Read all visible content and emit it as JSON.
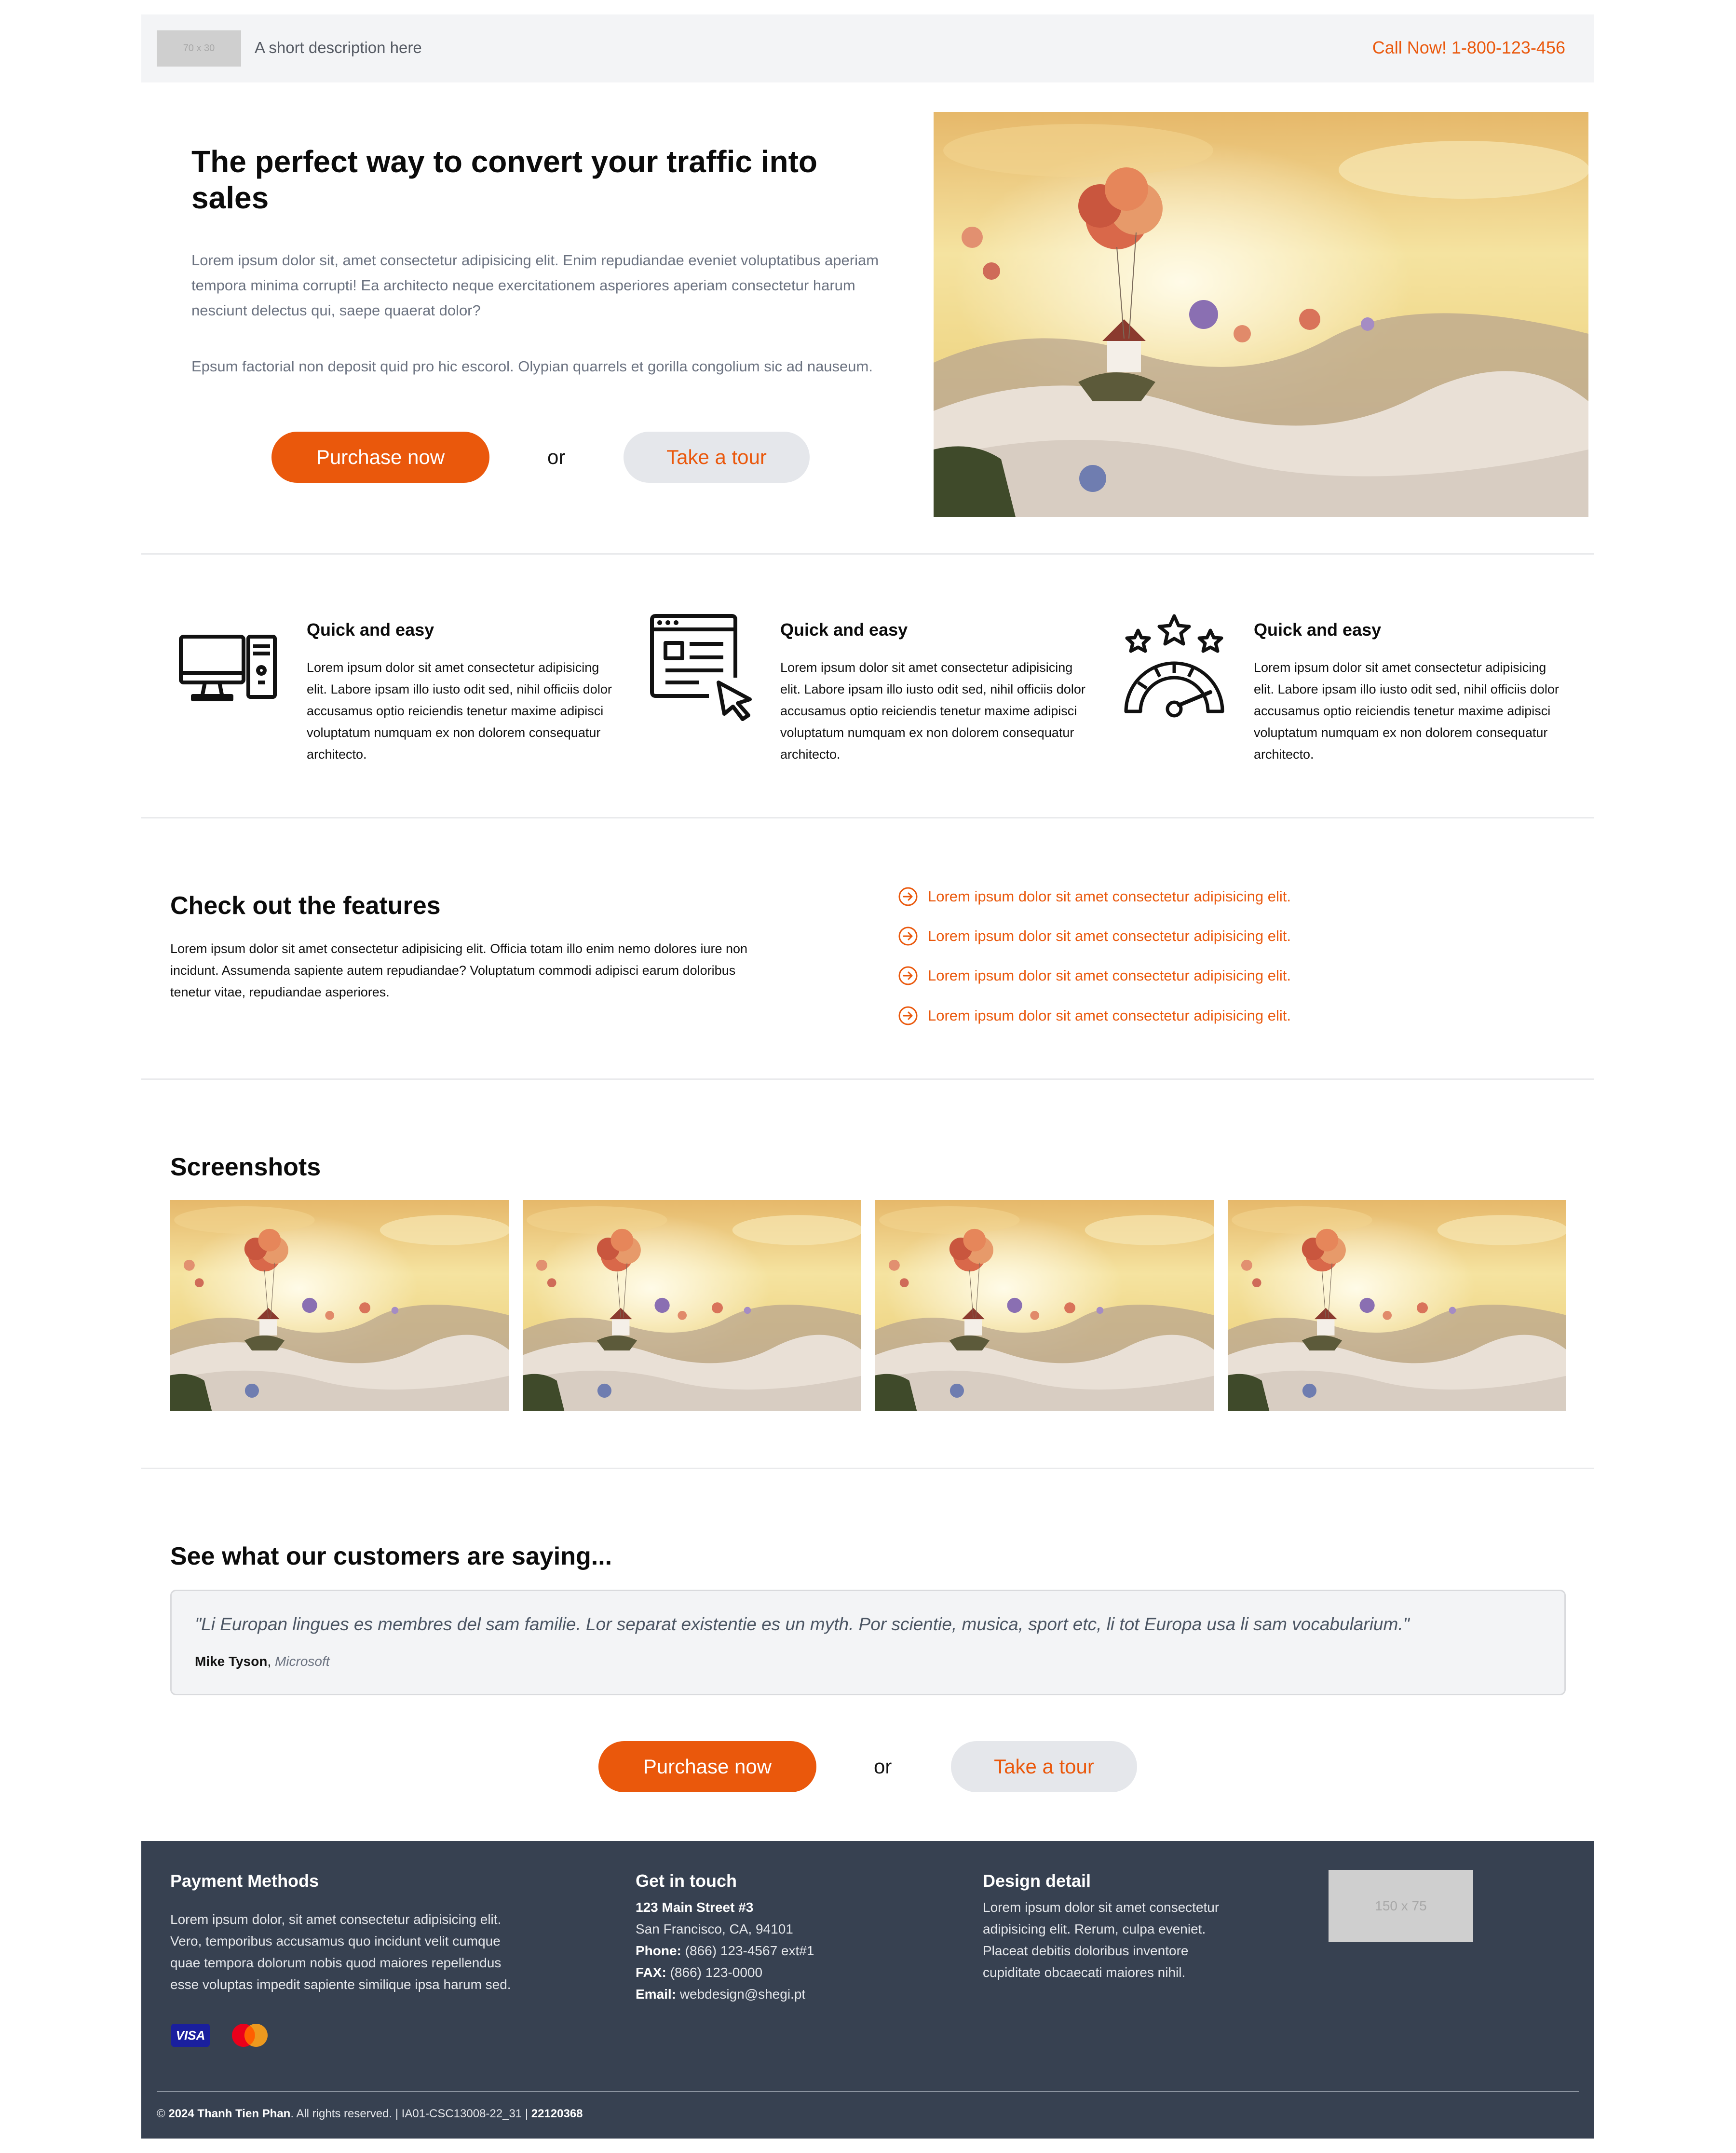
{
  "topbar": {
    "logo_placeholder": "70 x 30",
    "description": "A short description here",
    "phone": "Call Now! 1-800-123-456"
  },
  "hero": {
    "title": "The perfect way to convert your traffic into sales",
    "paragraph1": "Lorem ipsum dolor sit, amet consectetur adipisicing elit. Enim repudiandae eveniet voluptatibus aperiam tempora minima corrupti! Ea architecto neque exercitationem asperiores aperiam consectetur harum nesciunt delectus qui, saepe quaerat dolor?",
    "paragraph2": "Epsum factorial non deposit quid pro hic escorol. Olypian quarrels et gorilla congolium sic ad nauseum.",
    "purchase_label": "Purchase now",
    "or_label": "or",
    "tour_label": "Take a tour"
  },
  "features": [
    {
      "icon": "desktop-computer-icon",
      "title": "Quick and easy",
      "text": "Lorem ipsum dolor sit amet consectetur adipisicing elit. Labore ipsam illo iusto odit sed, nihil officiis dolor accusamus optio reiciendis tenetur maxime adipisci voluptatum numquam ex non dolorem consequatur architecto."
    },
    {
      "icon": "web-browser-click-icon",
      "title": "Quick and easy",
      "text": "Lorem ipsum dolor sit amet consectetur adipisicing elit. Labore ipsam illo iusto odit sed, nihil officiis dolor accusamus optio reiciendis tenetur maxime adipisci voluptatum numquam ex non dolorem consequatur architecto."
    },
    {
      "icon": "rating-gauge-icon",
      "title": "Quick and easy",
      "text": "Lorem ipsum dolor sit amet consectetur adipisicing elit. Labore ipsam illo iusto odit sed, nihil officiis dolor accusamus optio reiciendis tenetur maxime adipisci voluptatum numquam ex non dolorem consequatur architecto."
    }
  ],
  "check_features": {
    "title": "Check out the features",
    "text": "Lorem ipsum dolor sit amet consectetur adipisicing elit. Officia totam illo enim nemo dolores iure non incidunt. Assumenda sapiente autem repudiandae? Voluptatum commodi adipisci earum doloribus tenetur vitae, repudiandae asperiores.",
    "items": [
      "Lorem ipsum dolor sit amet consectetur adipisicing elit.",
      "Lorem ipsum dolor sit amet consectetur adipisicing elit.",
      "Lorem ipsum dolor sit amet consectetur adipisicing elit.",
      "Lorem ipsum dolor sit amet consectetur adipisicing elit."
    ]
  },
  "screenshots": {
    "title": "Screenshots"
  },
  "testimonials": {
    "title": "See what our customers are saying...",
    "quote": "\"Li Europan lingues es membres del sam familie. Lor separat existentie es un myth. Por scientie, musica, sport etc, li tot Europa usa li sam vocabularium.\"",
    "author": "Mike Tyson",
    "company": "Microsoft",
    "purchase_label": "Purchase now",
    "or_label": "or",
    "tour_label": "Take a tour"
  },
  "footer": {
    "payment_title": "Payment Methods",
    "payment_text": "Lorem ipsum dolor, sit amet consectetur adipisicing elit. Vero, temporibus accusamus quo incidunt velit cumque quae tempora dolorum nobis quod maiores repellendus esse voluptas impedit sapiente similique ipsa harum sed.",
    "payment_icons": [
      "visa-icon",
      "mastercard-icon"
    ],
    "visa_label": "VISA",
    "contact_title": "Get in touch",
    "street": "123 Main Street #3",
    "city": "San Francisco, CA, 94101",
    "phone_label": "Phone:",
    "phone": "(866) 123-4567 ext#1",
    "fax_label": "FAX:",
    "fax": "(866) 123-0000",
    "email_label": "Email:",
    "email": "webdesign@shegi.pt",
    "design_title": "Design detail",
    "design_text": "Lorem ipsum dolor sit amet consectetur adipisicing elit. Rerum, culpa eveniet. Placeat debitis doloribus inventore cupiditate obcaecati maiores nihil.",
    "logo_placeholder": "150 x 75",
    "copy_prefix": "© ",
    "copy_year_name": "2024 Thanh Tien Phan",
    "copy_middle": ". All rights reserved. | IA01-CSC13008-22_31 | ",
    "copy_id": "22120368"
  },
  "colors": {
    "accent": "#ea580c",
    "footer_bg": "#374151",
    "topbar_bg": "#f3f4f6"
  }
}
